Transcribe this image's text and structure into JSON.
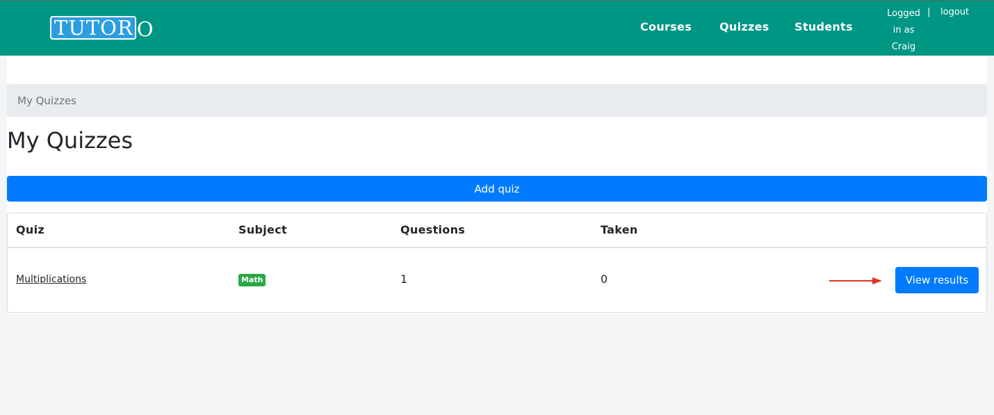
{
  "brand": {
    "boxed_text": "TUTOR",
    "tail_text": "O"
  },
  "nav": {
    "links": [
      "Courses",
      "Quizzes",
      "Students"
    ],
    "user_lines": [
      "Logged",
      "in as",
      "Craig"
    ],
    "separator": "|",
    "logout_label": "logout"
  },
  "breadcrumb": {
    "current": "My Quizzes"
  },
  "page": {
    "title": "My Quizzes",
    "add_quiz_label": "Add quiz"
  },
  "table": {
    "headers": [
      "Quiz",
      "Subject",
      "Questions",
      "Taken"
    ],
    "rows": [
      {
        "quiz": "Multiplications",
        "subject": "Math",
        "subject_color": "#28a745",
        "questions": "1",
        "taken": "0",
        "action_label": "View results"
      }
    ]
  },
  "colors": {
    "navbar": "#009684",
    "primary": "#007bff",
    "annotation_arrow": "#e0311f"
  }
}
